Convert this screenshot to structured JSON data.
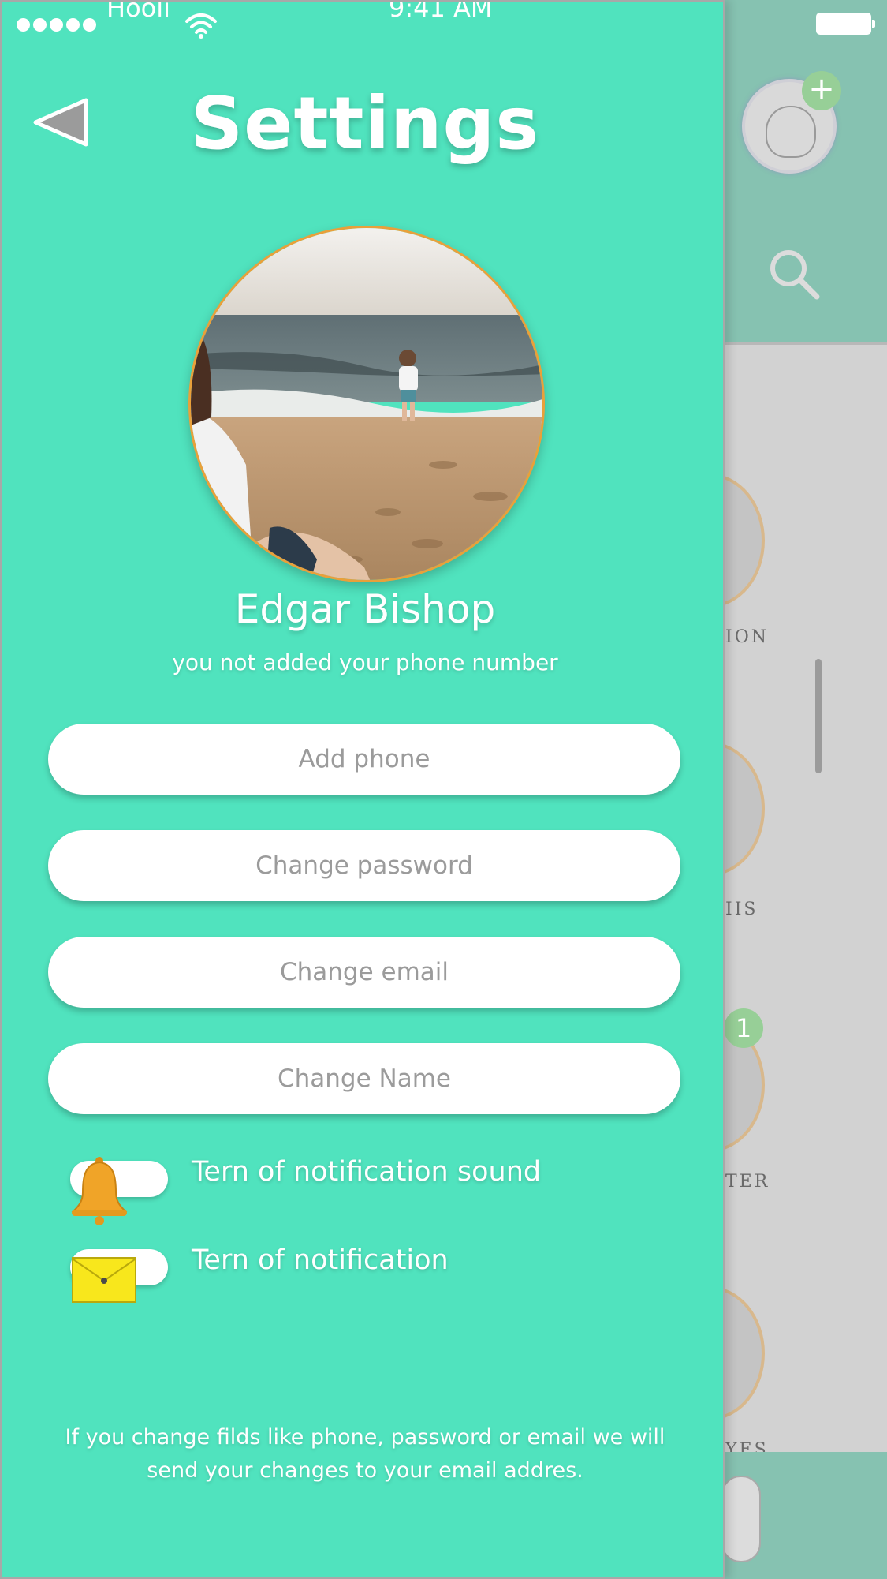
{
  "status_bar": {
    "carrier": "Hooli",
    "time": "9:41 AM"
  },
  "header": {
    "title": "Settings",
    "back_icon": "back-triangle-icon"
  },
  "profile": {
    "name": "Edgar Bishop",
    "phone_note": "you not added your phone number",
    "avatar_border_color": "#e9a03a"
  },
  "actions": [
    {
      "label": "Add phone"
    },
    {
      "label": "Change password"
    },
    {
      "label": "Change email"
    },
    {
      "label": "Change Name"
    }
  ],
  "toggles": [
    {
      "icon": "bell-icon",
      "label": "Tern of notification sound"
    },
    {
      "icon": "envelope-icon",
      "label": "Tern of notification"
    }
  ],
  "footer": {
    "note": "If you change filds like phone, password or email we will send your changes to your email addres."
  },
  "background": {
    "badge_count": "1",
    "labels": [
      "ION",
      "IIS",
      "TER",
      "YES"
    ]
  },
  "colors": {
    "panel": "#50e3be",
    "button_bg": "#ffffff",
    "button_text": "#9b9b9b",
    "bell": "#f0a428",
    "envelope": "#f8e71c"
  }
}
